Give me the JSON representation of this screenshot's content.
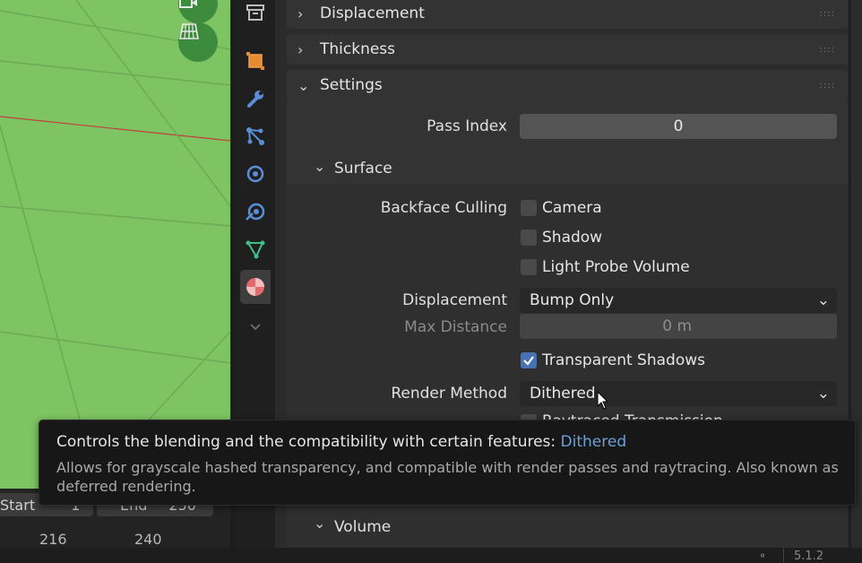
{
  "timeline": {
    "start_label": "Start",
    "start_value": "1",
    "end_label": "End",
    "end_value": "250",
    "ticks": [
      "216",
      "240"
    ]
  },
  "tabs": [
    {
      "name": "scene-collection",
      "icon": "archive-icon"
    },
    {
      "name": "object",
      "icon": "object-icon"
    },
    {
      "name": "modifiers",
      "icon": "wrench-icon"
    },
    {
      "name": "particles",
      "icon": "particles-icon"
    },
    {
      "name": "physics",
      "icon": "physics-icon"
    },
    {
      "name": "constraints",
      "icon": "constraint-icon"
    },
    {
      "name": "data",
      "icon": "mesh-data-icon"
    },
    {
      "name": "material",
      "icon": "material-icon",
      "active": true
    }
  ],
  "panels": {
    "displacement": "Displacement",
    "thickness": "Thickness",
    "settings": "Settings",
    "volume": "Volume"
  },
  "settings": {
    "pass_index_label": "Pass Index",
    "pass_index_value": "0",
    "surface_label": "Surface",
    "backface_culling_label": "Backface Culling",
    "camera_label": "Camera",
    "camera_checked": false,
    "shadow_label": "Shadow",
    "shadow_checked": false,
    "light_probe_label": "Light Probe Volume",
    "light_probe_checked": false,
    "displacement_label": "Displacement",
    "displacement_value": "Bump Only",
    "max_distance_label": "Max Distance",
    "max_distance_value": "0 m",
    "transparent_shadows_label": "Transparent Shadows",
    "transparent_shadows_checked": true,
    "render_method_label": "Render Method",
    "render_method_value": "Dithered",
    "partial_label": "Raytraced Transmission"
  },
  "tooltip": {
    "title_prefix": "Controls the blending and the compatibility with certain features:",
    "title_highlight": "Dithered",
    "description": "Allows for grayscale hashed transparency, and compatible with render passes and raytracing. Also known as deferred rendering."
  },
  "status": {
    "version": "5.1.2"
  },
  "colors": {
    "viewport_bg": "#7ec463",
    "accent_blue": "#4772b3",
    "tooltip_highlight": "#6c9fd6"
  }
}
